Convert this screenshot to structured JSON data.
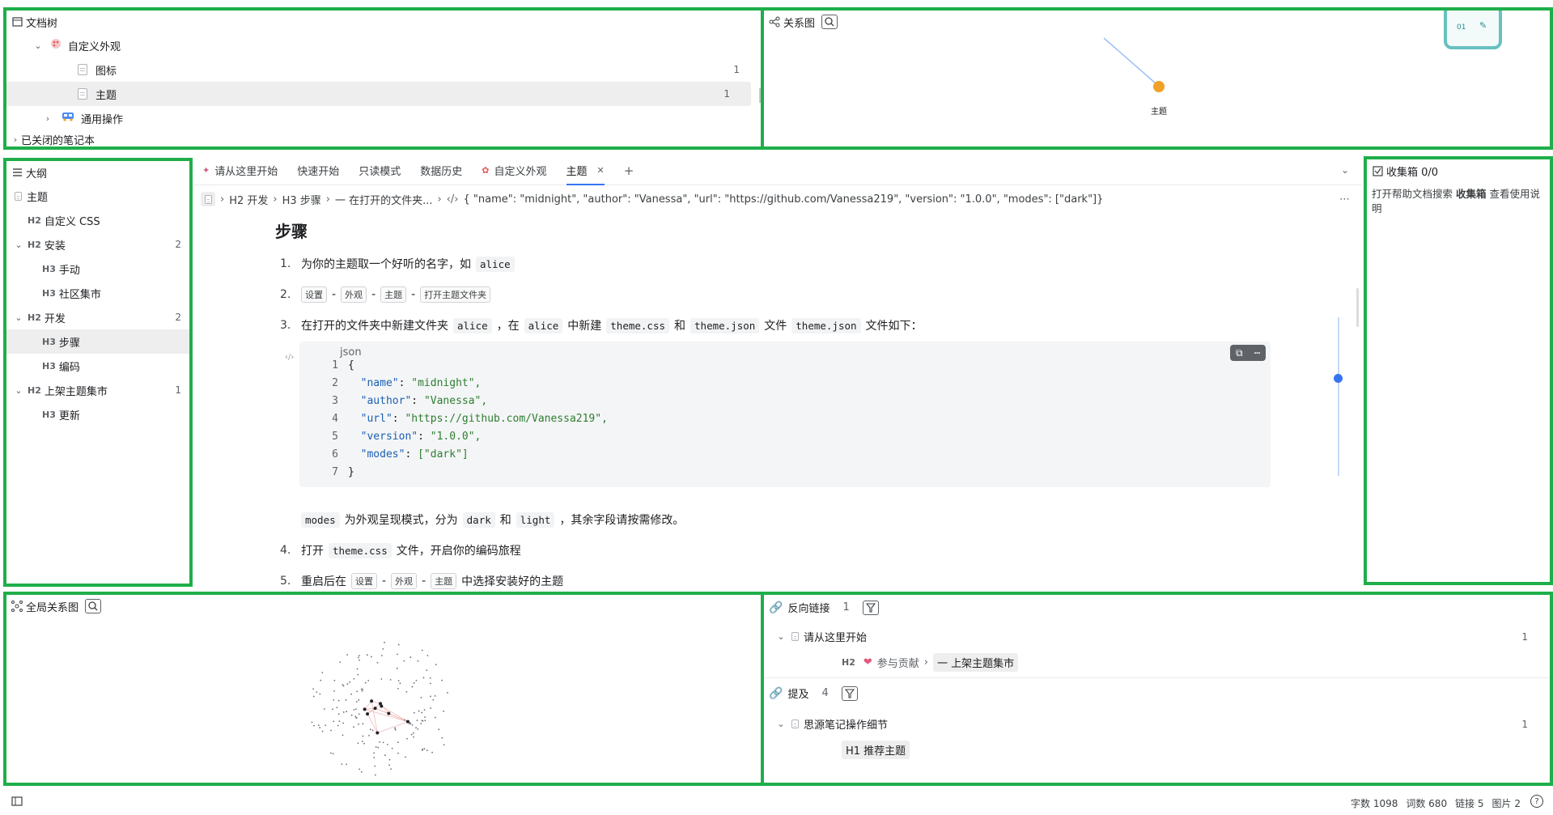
{
  "tree": {
    "title": "文档树",
    "items": [
      {
        "label": "自定义外观"
      },
      {
        "label": "图标",
        "count": "1"
      },
      {
        "label": "主题",
        "count": "1"
      },
      {
        "label": "通用操作"
      },
      {
        "label": "已关闭的笔记本"
      }
    ]
  },
  "graph": {
    "title": "关系图",
    "node_label": "主题",
    "node_color": "#f0a127"
  },
  "outline": {
    "title": "大纲",
    "items": [
      {
        "level": "",
        "label": "主题"
      },
      {
        "level": "H2",
        "label": "自定义 CSS"
      },
      {
        "level": "H2",
        "label": "安装",
        "count": "2"
      },
      {
        "level": "H3",
        "label": "手动"
      },
      {
        "level": "H3",
        "label": "社区集市"
      },
      {
        "level": "H2",
        "label": "开发",
        "count": "2"
      },
      {
        "level": "H3",
        "label": "步骤"
      },
      {
        "level": "H3",
        "label": "编码"
      },
      {
        "level": "H2",
        "label": "上架主题集市",
        "count": "1"
      },
      {
        "level": "H3",
        "label": "更新"
      }
    ]
  },
  "tabs": [
    "请从这里开始",
    "快速开始",
    "只读模式",
    "数据历史",
    "自定义外观",
    "主题"
  ],
  "breadcrumb": {
    "items": [
      "H2 开发",
      "H3 步骤",
      "一 在打开的文件夹..."
    ],
    "code": "{ \"name\": \"midnight\", \"author\": \"Vanessa\", \"url\": \"https://github.com/Vanessa219\", \"version\": \"1.0.0\", \"modes\": [\"dark\"]}"
  },
  "editor": {
    "heading": "步骤",
    "step1": {
      "num": "1.",
      "text": "为你的主题取一个好听的名字，如",
      "code": "alice"
    },
    "step2": {
      "num": "2.",
      "keys": [
        "设置",
        "外观",
        "主题",
        "打开主题文件夹"
      ],
      "sep": "-"
    },
    "step3": {
      "num": "3.",
      "t1": "在打开的文件夹中新建文件夹",
      "c1": "alice",
      "t2": "，在",
      "c2": "alice",
      "t3": "中新建",
      "c3": "theme.css",
      "t4": "和",
      "c4": "theme.json",
      "t5": "文件",
      "c5": "theme.json",
      "t6": "文件如下："
    },
    "code_lang": "json",
    "code_lines": [
      {
        "n": "1",
        "t": "{"
      },
      {
        "n": "2",
        "k": "\"name\"",
        "v": "\"midnight\","
      },
      {
        "n": "3",
        "k": "\"author\"",
        "v": "\"Vanessa\","
      },
      {
        "n": "4",
        "k": "\"url\"",
        "v": "\"https://github.com/Vanessa219\","
      },
      {
        "n": "5",
        "k": "\"version\"",
        "v": "\"1.0.0\","
      },
      {
        "n": "6",
        "k": "\"modes\"",
        "v": "[\"dark\"]"
      },
      {
        "n": "7",
        "t": "}"
      }
    ],
    "modes_note": {
      "c1": "modes",
      "t1": "为外观呈现模式，分为",
      "c2": "dark",
      "t2": "和",
      "c3": "light",
      "t3": "，其余字段请按需修改。"
    },
    "step4": {
      "num": "4.",
      "t1": "打开",
      "c1": "theme.css",
      "t2": "文件，开启你的编码旅程"
    },
    "step5": {
      "num": "5.",
      "t1": "重启后在",
      "keys": [
        "设置",
        "外观",
        "主题"
      ],
      "t2": "中选择安装好的主题"
    }
  },
  "inbox": {
    "title": "收集箱 0/0",
    "hint_pre": "打开帮助文档搜索",
    "hint_bold": "收集箱",
    "hint_post": "查看使用说明"
  },
  "global_graph": {
    "title": "全局关系图"
  },
  "backlinks": {
    "title": "反向链接",
    "count": "1",
    "doc": "请从这里开始",
    "doc_count": "1",
    "path": [
      "H2",
      "参与贡献",
      "一 上架主题集市"
    ],
    "mention_title": "提及",
    "mention_count": "4",
    "mention_doc": "思源笔记操作细节",
    "mention_doc_count": "1",
    "mention_item": "H1 推荐主题"
  },
  "status": {
    "chars": "字数 1098",
    "words": "词数 680",
    "links": "链接 5",
    "images": "图片 2"
  }
}
